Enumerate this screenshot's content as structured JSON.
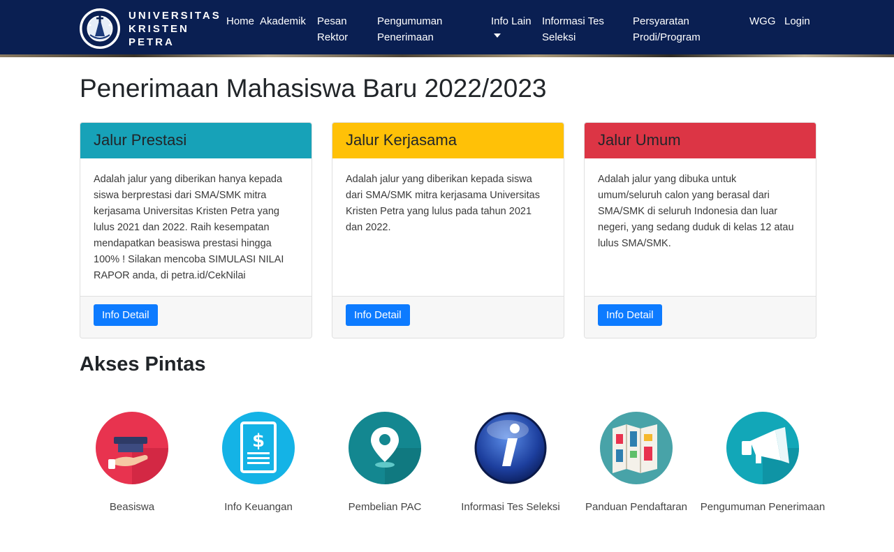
{
  "brand": {
    "line1": "UNIVERSITAS",
    "line2": "KRISTEN",
    "line3": "PETRA"
  },
  "nav": {
    "home": "Home",
    "akademik": "Akademik",
    "pesan_l1": "Pesan",
    "pesan_l2": "Rektor",
    "pengumuman_l1": "Pengumuman",
    "pengumuman_l2": "Penerimaan",
    "info_lain": "Info Lain",
    "infotes_l1": "Informasi Tes",
    "infotes_l2": "Seleksi",
    "persyaratan_l1": "Persyaratan",
    "persyaratan_l2": "Prodi/Program",
    "wgg": "WGG",
    "login": "Login"
  },
  "page_title": "Penerimaan Mahasiswa Baru 2022/2023",
  "cards": [
    {
      "title": "Jalur Prestasi",
      "color": "#17a2b8",
      "body": "Adalah jalur yang diberikan hanya kepada siswa berprestasi dari SMA/SMK mitra kerjasama Universitas Kristen Petra yang lulus 2021 dan 2022. Raih kesempatan mendapatkan beasiswa prestasi hingga 100% ! Silakan mencoba SIMULASI NILAI RAPOR anda, di petra.id/CekNilai",
      "button": "Info Detail"
    },
    {
      "title": "Jalur Kerjasama",
      "color": "#ffc107",
      "body": "Adalah jalur yang diberikan kepada siswa dari SMA/SMK mitra kerjasama Universitas Kristen Petra yang lulus pada tahun 2021 dan 2022.",
      "button": "Info Detail"
    },
    {
      "title": "Jalur Umum",
      "color": "#dc3545",
      "body": "Adalah jalur yang dibuka untuk umum/seluruh calon yang berasal dari SMA/SMK di seluruh Indonesia dan luar negeri, yang sedang duduk di kelas 12 atau lulus SMA/SMK.",
      "button": "Info Detail"
    }
  ],
  "section_title": "Akses Pintas",
  "shortcuts": [
    {
      "label": "Beasiswa",
      "icon": "scholarship-icon"
    },
    {
      "label": "Info Keuangan",
      "icon": "finance-document-icon"
    },
    {
      "label": "Pembelian PAC",
      "icon": "location-pin-icon"
    },
    {
      "label": "Informasi Tes Seleksi",
      "icon": "info-icon"
    },
    {
      "label": "Panduan Pendaftaran",
      "icon": "map-guide-icon"
    },
    {
      "label": "Pengumuman Penerimaan",
      "icon": "megaphone-icon"
    }
  ],
  "colors": {
    "navbar": "#0a1f52",
    "button": "#0d7bff"
  }
}
